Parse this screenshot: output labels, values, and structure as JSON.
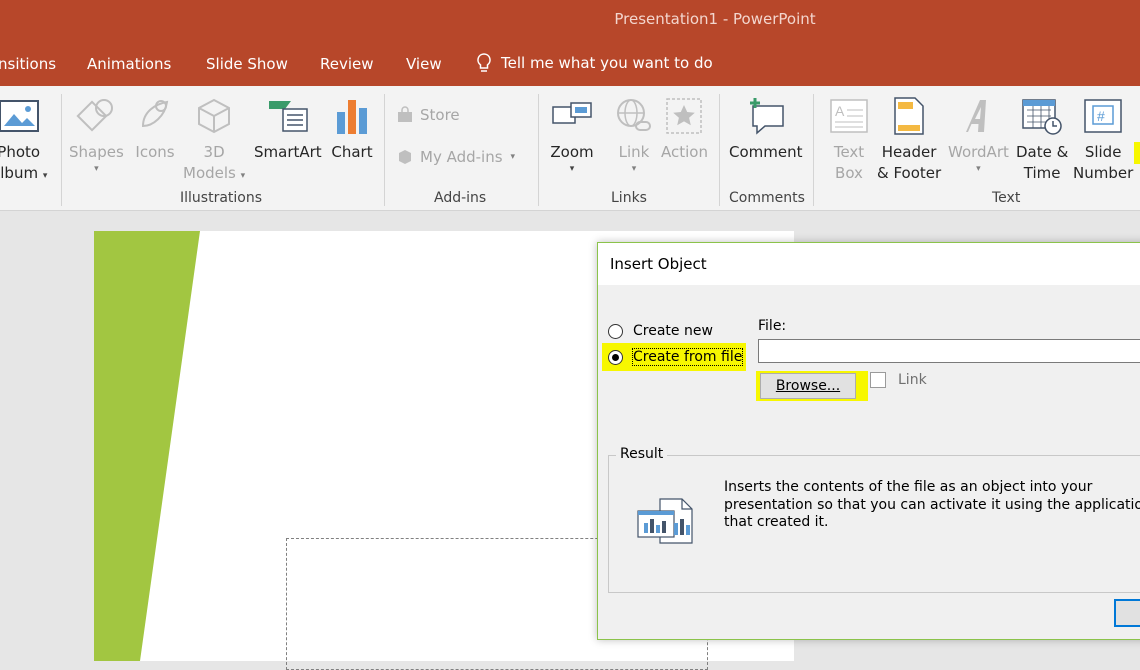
{
  "window": {
    "title": "Presentation1  -  PowerPoint"
  },
  "tabs": [
    "nsitions",
    "Animations",
    "Slide Show",
    "Review",
    "View"
  ],
  "tell_me": "Tell me what you want to do",
  "ribbon": {
    "photo_album": {
      "line1": "Photo",
      "line2": "Album",
      "caret": "▾"
    },
    "shapes": {
      "label": "Shapes",
      "caret": "▾"
    },
    "icons": {
      "label": "Icons"
    },
    "models3d": {
      "line1": "3D",
      "line2": "Models",
      "caret": "▾"
    },
    "smartart": {
      "label": "SmartArt"
    },
    "chart": {
      "label": "Chart"
    },
    "store": {
      "label": "Store"
    },
    "my_addins": {
      "label": "My Add-ins",
      "caret": "▾"
    },
    "zoom": {
      "label": "Zoom",
      "caret": "▾"
    },
    "link": {
      "label": "Link",
      "caret": "▾"
    },
    "action": {
      "label": "Action"
    },
    "comment": {
      "label": "Comment"
    },
    "textbox": {
      "line1": "Text",
      "line2": "Box"
    },
    "header_footer": {
      "line1": "Header",
      "line2": "& Footer"
    },
    "wordart": {
      "label": "WordArt",
      "caret": "▾"
    },
    "date_time": {
      "line1": "Date &",
      "line2": "Time"
    },
    "slide_number": {
      "line1": "Slide",
      "line2": "Number"
    },
    "groups": {
      "illustrations": "Illustrations",
      "addins": "Add-ins",
      "links": "Links",
      "comments": "Comments",
      "text": "Text"
    }
  },
  "dialog": {
    "title": "Insert Object",
    "create_new": "Create new",
    "create_from_file": "Create from file",
    "file_label": "File:",
    "file_value": "",
    "browse": "Browse...",
    "link": "Link",
    "result_label": "Result",
    "result_text": "Inserts the contents of the file as an object into your presentation so that you can activate it using the application that created it.",
    "ok": ""
  },
  "colors": {
    "accent": "#b7472a",
    "highlight": "#f7f700",
    "slide_green": "#a2c641"
  }
}
